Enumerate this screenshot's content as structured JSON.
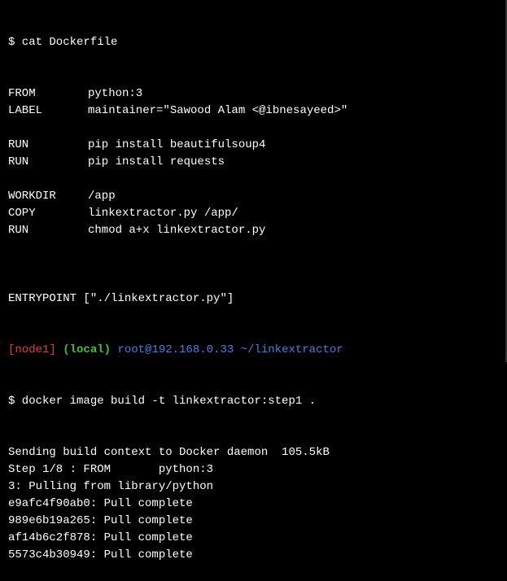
{
  "terminal": {
    "cat_command": "$ cat Dockerfile",
    "dockerfile": [
      {
        "instr": "FROM",
        "arg": "python:3"
      },
      {
        "instr": "LABEL",
        "arg": "maintainer=\"Sawood Alam <@ibnesayeed>\""
      },
      {
        "instr": "",
        "arg": ""
      },
      {
        "instr": "RUN",
        "arg": "pip install beautifulsoup4"
      },
      {
        "instr": "RUN",
        "arg": "pip install requests"
      },
      {
        "instr": "",
        "arg": ""
      },
      {
        "instr": "WORKDIR",
        "arg": "/app"
      },
      {
        "instr": "COPY",
        "arg": "linkextractor.py /app/"
      },
      {
        "instr": "RUN",
        "arg": "chmod a+x linkextractor.py"
      },
      {
        "instr": "",
        "arg": ""
      }
    ],
    "entrypoint": "ENTRYPOINT [\"./linkextractor.py\"]",
    "prompt": {
      "node": "[node1]",
      "env": "(local)",
      "user_host": "root@192.168.0.33",
      "path": "~/linkextractor"
    },
    "build_command": "$ docker image build -t linkextractor:step1 .",
    "output": [
      "Sending build context to Docker daemon  105.5kB",
      "Step 1/8 : FROM       python:3",
      "3: Pulling from library/python",
      "e9afc4f90ab0: Pull complete",
      "989e6b19a265: Pull complete",
      "af14b6c2f878: Pull complete",
      "5573c4b30949: Pull complete"
    ],
    "colors": {
      "background": "#000000",
      "text": "#ffffff",
      "prompt_node": "#e04040",
      "prompt_env": "#40c040",
      "prompt_path": "#4a7fe0"
    }
  }
}
